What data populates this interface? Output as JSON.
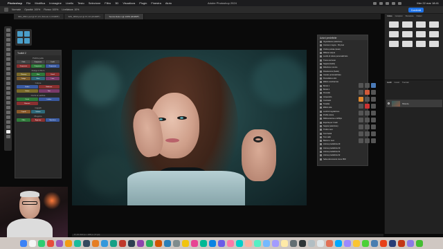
{
  "menubar": {
    "app": "Photoshop",
    "window_title": "Adobe Photoshop 2024",
    "clock": "Mer 22 mar 18:41",
    "items": [
      "File",
      "Modifica",
      "Immagine",
      "Livello",
      "Testo",
      "Selezione",
      "Filtro",
      "3D",
      "Visualizza",
      "Plugin",
      "Finestra",
      "Aiuto"
    ]
  },
  "options_bar": {
    "items": [
      "Normale",
      "Opacità: 100%",
      "Flusso: 100%",
      "Livellatura: 10%"
    ],
    "share_label": "Condividi"
  },
  "tabs": [
    {
      "label": "IMG_8831.psd @ 67,1% (Sfondo 3, RGB/8*)",
      "active": false
    },
    {
      "label": "IMG_8840.psd @ 67,1% (RGB/8*)",
      "active": false
    },
    {
      "label": "Senza titolo-1 @ 100% (RGB/8*)",
      "active": true
    }
  ],
  "toolkit": {
    "title": "Toolkit 2",
    "sections": [
      "Pulizia pelle",
      "Dodge & Burn",
      "Colore",
      "Occhi & Labbra",
      "Capelli",
      "Plug-Ins"
    ],
    "buttons": [
      {
        "label": "Pelle",
        "color": "#444444"
      },
      {
        "label": "Frequenza",
        "color": "#444444"
      },
      {
        "label": "Livelli",
        "color": "#444444"
      },
      {
        "label": "Frequenze",
        "color": "#8a3030"
      },
      {
        "label": "Frequenze",
        "color": "#2f7a3a"
      },
      {
        "label": "Frequenze",
        "color": "#3a5aa0"
      },
      {
        "label": "Cleanup",
        "color": "#7a6a2a"
      },
      {
        "label": "Skin",
        "color": "#2f7a3a"
      },
      {
        "label": "Detail",
        "color": "#8a3030"
      },
      {
        "label": "Dodge",
        "color": "#7a5a2a"
      },
      {
        "label": "Burn",
        "color": "#2f6a7a"
      },
      {
        "label": "Luce",
        "color": "#7a3a6a"
      },
      {
        "label": "Ombre",
        "color": "#3a5aa0"
      },
      {
        "label": "Nitidezza",
        "color": "#8a3030"
      },
      {
        "label": "Colore",
        "color": "#7a6a2a"
      },
      {
        "label": "Toni",
        "color": "#7a3a6a"
      },
      {
        "label": "Occhi",
        "color": "#2f7a3a"
      },
      {
        "label": "Labbra",
        "color": "#3a5aa0"
      },
      {
        "label": "Rimuovi",
        "color": "#8a3030"
      },
      {
        "label": "Capelli",
        "color": "#8a5a2a"
      },
      {
        "label": "Volume",
        "color": "#2f6a7a"
      },
      {
        "label": "Filtro",
        "color": "#2f7a3a"
      },
      {
        "label": "Aggiungi",
        "color": "#8a3030"
      },
      {
        "label": "Ripristina",
        "color": "#3a5aa0"
      }
    ]
  },
  "actions": {
    "title": "Azioni predefinite",
    "items": [
      "Vignettatura (selezione)",
      "Cornice in legno - 50 pixel",
      "Ombre portate (testo)",
      "Riflesso acqua",
      "Livello di colore personalizzato",
      "Trama nel testo",
      "Seppia (livello)",
      "Riduzione rumore",
      "Dissolvenza (livello)",
      "Canale personalizzato",
      "Pennellata a olio",
      "Effetto vecchia foto",
      "Bordo 1",
      "Bordo 2",
      "Pennello",
      "Acquerello",
      "Contrasto",
      "Tonalità",
      "Effetto tela",
      "Livelli di regolazione",
      "Profilo colore",
      "Ridimensiona a 1200px",
      "Esporta per il web",
      "Seppia (selezione)",
      "Timbro nero",
      "Toni freddi",
      "Toni caldi",
      "Bianco e nero",
      "Azione predefinita 29",
      "Azione predefinita 30",
      "Azione predefinita 31",
      "Azione predefinita 32",
      "Salva documento come PDF"
    ]
  },
  "right_dock": {
    "top_tabs": [
      "Colore",
      "Campioni",
      "Sfumature",
      "Pattern"
    ],
    "layers_tabs": [
      "Livelli",
      "Canali",
      "Tracciati"
    ],
    "layer_name": "Sfondo"
  },
  "status": "67,1%  1920 px x 1280 px (72 ppi)"
}
